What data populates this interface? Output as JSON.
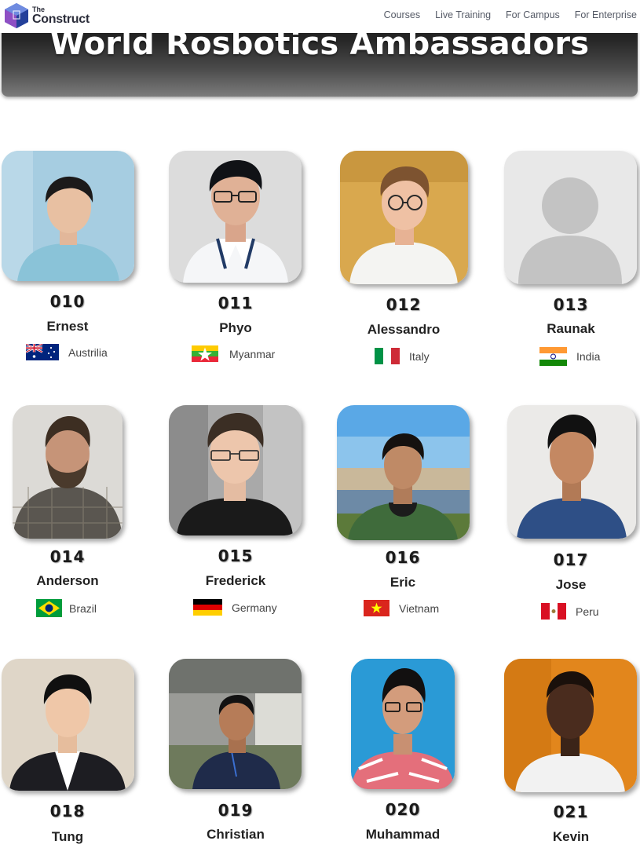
{
  "brand": {
    "the": "The",
    "name": "Construct"
  },
  "nav": {
    "courses": "Courses",
    "live_training": "Live Training",
    "for_campus": "For Campus",
    "for_enterprise": "For Enterprise"
  },
  "hero": {
    "title": "World Rosbotics Ambassadors"
  },
  "ambassadors": [
    {
      "number": "010",
      "name": "Ernest",
      "country": "Austrilia",
      "flag": "australia-flag"
    },
    {
      "number": "011",
      "name": "Phyo",
      "country": "Myanmar",
      "flag": "myanmar-flag"
    },
    {
      "number": "012",
      "name": "Alessandro",
      "country": "Italy",
      "flag": "italy-flag"
    },
    {
      "number": "013",
      "name": "Raunak",
      "country": "India",
      "flag": "india-flag"
    },
    {
      "number": "014",
      "name": "Anderson",
      "country": "Brazil",
      "flag": "brazil-flag"
    },
    {
      "number": "015",
      "name": "Frederick",
      "country": "Germany",
      "flag": "germany-flag"
    },
    {
      "number": "016",
      "name": "Eric",
      "country": "Vietnam",
      "flag": "vietnam-flag"
    },
    {
      "number": "017",
      "name": "Jose",
      "country": "Peru",
      "flag": "peru-flag"
    },
    {
      "number": "018",
      "name": "Tung",
      "country": "",
      "flag": ""
    },
    {
      "number": "019",
      "name": "Christian",
      "country": "",
      "flag": ""
    },
    {
      "number": "020",
      "name": "Muhammad",
      "country": "",
      "flag": ""
    },
    {
      "number": "021",
      "name": "Kevin",
      "country": "",
      "flag": ""
    }
  ],
  "colors": {
    "hero_top": "#1b1b1b",
    "hero_bottom": "#7c7c7c",
    "text": "#222222",
    "nav_text": "#555a66"
  }
}
